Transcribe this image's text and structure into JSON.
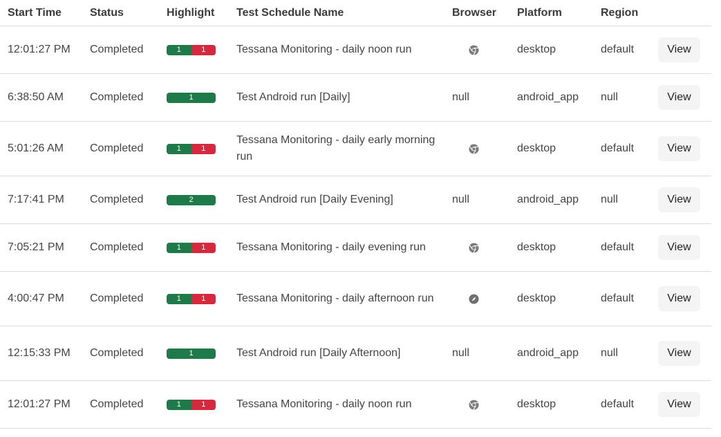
{
  "headers": {
    "start_time": "Start Time",
    "status": "Status",
    "highlight": "Highlight",
    "name": "Test Schedule Name",
    "browser": "Browser",
    "platform": "Platform",
    "region": "Region"
  },
  "colors": {
    "pass": "#1f7a4a",
    "fail": "#d7283d"
  },
  "rows": [
    {
      "start_time": "12:01:27 PM",
      "status": "Completed",
      "pass": "1",
      "fail": "1",
      "name": "Tessana Monitoring - daily noon run",
      "browser": "chrome-icon",
      "platform": "desktop",
      "region": "default",
      "action": "View"
    },
    {
      "start_time": "6:38:50 AM",
      "status": "Completed",
      "pass": "1",
      "fail": "",
      "name": "Test Android run [Daily]",
      "browser": "null",
      "platform": "android_app",
      "region": "null",
      "action": "View"
    },
    {
      "start_time": "5:01:26 AM",
      "status": "Completed",
      "pass": "1",
      "fail": "1",
      "name": "Tessana Monitoring - daily early morning run",
      "browser": "chrome-icon",
      "platform": "desktop",
      "region": "default",
      "action": "View"
    },
    {
      "start_time": "7:17:41 PM",
      "status": "Completed",
      "pass": "2",
      "fail": "",
      "name": "Test Android run [Daily Evening]",
      "browser": "null",
      "platform": "android_app",
      "region": "null",
      "action": "View"
    },
    {
      "start_time": "7:05:21 PM",
      "status": "Completed",
      "pass": "1",
      "fail": "1",
      "name": "Tessana Monitoring - daily evening run",
      "browser": "chrome-icon",
      "platform": "desktop",
      "region": "default",
      "action": "View"
    },
    {
      "start_time": "4:00:47 PM",
      "status": "Completed",
      "pass": "1",
      "fail": "1",
      "name": "Tessana Monitoring - daily afternoon run",
      "browser": "safari-icon",
      "platform": "desktop",
      "region": "default",
      "action": "View"
    },
    {
      "start_time": "12:15:33 PM",
      "status": "Completed",
      "pass": "1",
      "fail": "",
      "name": "Test Android run [Daily Afternoon]",
      "browser": "null",
      "platform": "android_app",
      "region": "null",
      "action": "View"
    },
    {
      "start_time": "12:01:27 PM",
      "status": "Completed",
      "pass": "1",
      "fail": "1",
      "name": "Tessana Monitoring - daily noon run",
      "browser": "chrome-icon",
      "platform": "desktop",
      "region": "default",
      "action": "View"
    }
  ]
}
